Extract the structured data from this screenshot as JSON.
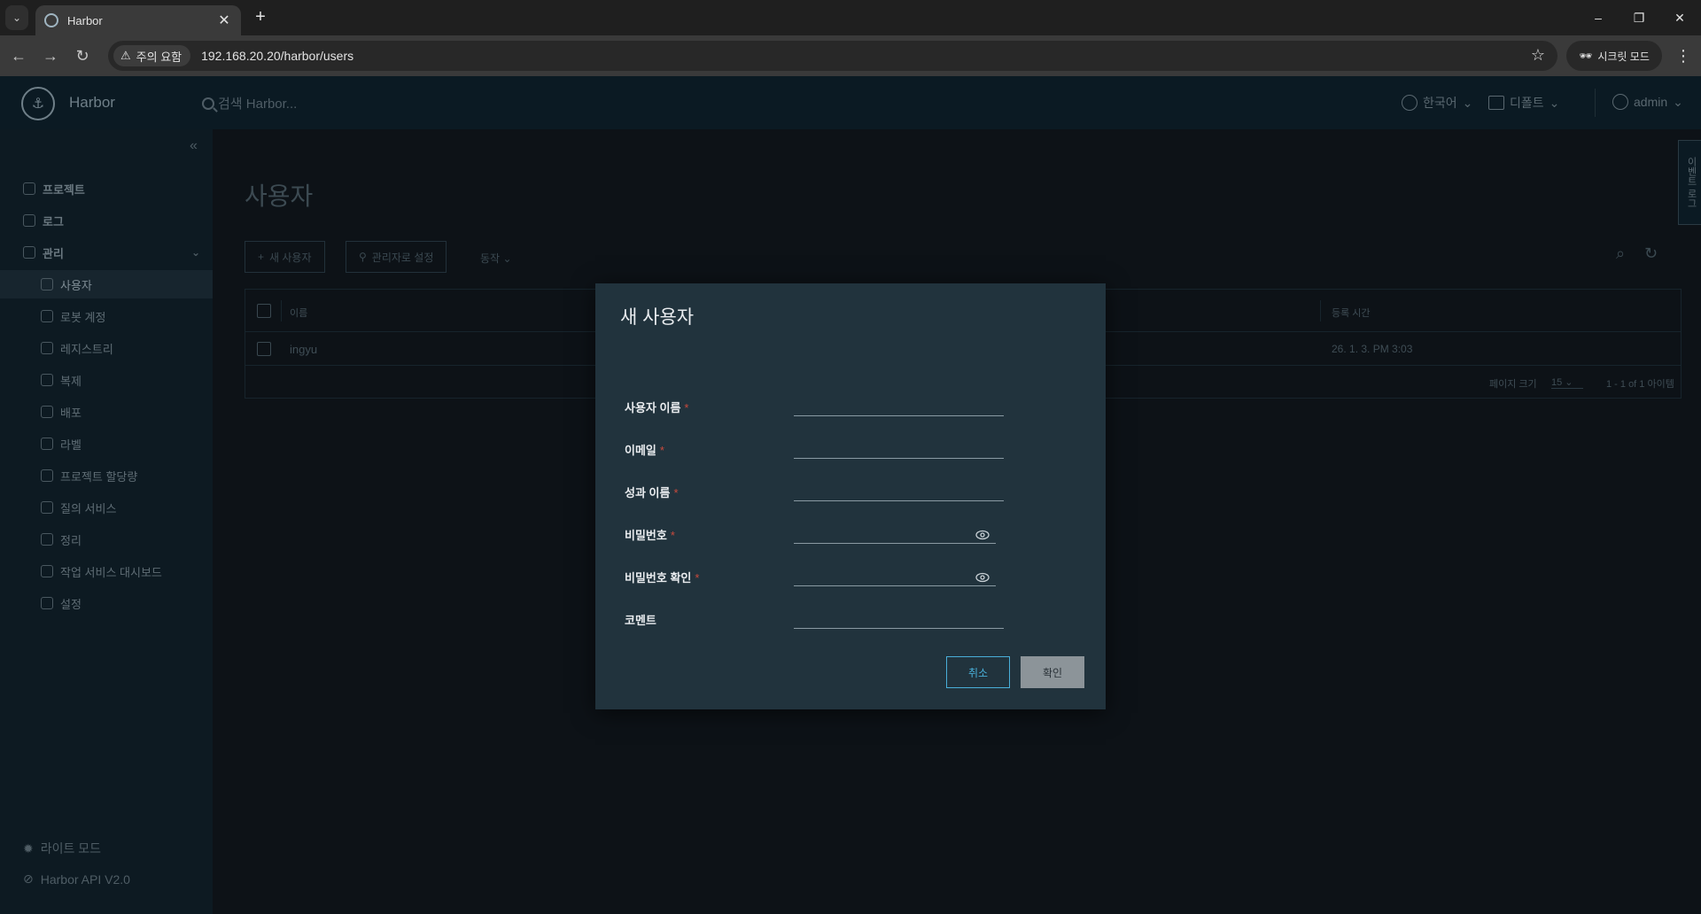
{
  "browser": {
    "tab_title": "Harbor",
    "security_chip": "주의 요함",
    "url": "192.168.20.20/harbor/users",
    "incognito_label": "시크릿 모드"
  },
  "header": {
    "brand": "Harbor",
    "search_placeholder": "검색 Harbor...",
    "language": "한국어",
    "date_format": "디폴트",
    "user": "admin"
  },
  "sidebar": {
    "projects": "프로젝트",
    "logs": "로그",
    "admin": "관리",
    "items": [
      "사용자",
      "로봇 계정",
      "레지스트리",
      "복제",
      "배포",
      "라벨",
      "프로젝트 할당량",
      "질의 서비스",
      "정리",
      "작업 서비스 대시보드",
      "설정"
    ],
    "light_mode": "라이트 모드",
    "api_version": "Harbor API V2.0"
  },
  "main": {
    "title": "사용자",
    "new_user_btn": "새 사용자",
    "set_admin_btn": "관리자로 설정",
    "action_dd": "동작",
    "columns": {
      "name": "이름",
      "created": "등록 시간"
    },
    "rows": [
      {
        "name": "ingyu",
        "created": "26. 1. 3. PM 3:03"
      }
    ],
    "page_size_label": "페이지 크기",
    "page_size": "15",
    "pagination": "1 - 1 of 1 아이템"
  },
  "side_tab": "이벤트 로그",
  "modal": {
    "title": "새 사용자",
    "fields": {
      "username": "사용자 이름",
      "email": "이메일",
      "fullname": "성과 이름",
      "password": "비밀번호",
      "confirm_password": "비밀번호 확인",
      "comment": "코멘트"
    },
    "cancel": "취소",
    "ok": "확인"
  },
  "colors": {
    "accent": "#49afd9",
    "required": "#c94a3d",
    "modal_bg": "#21333d"
  }
}
